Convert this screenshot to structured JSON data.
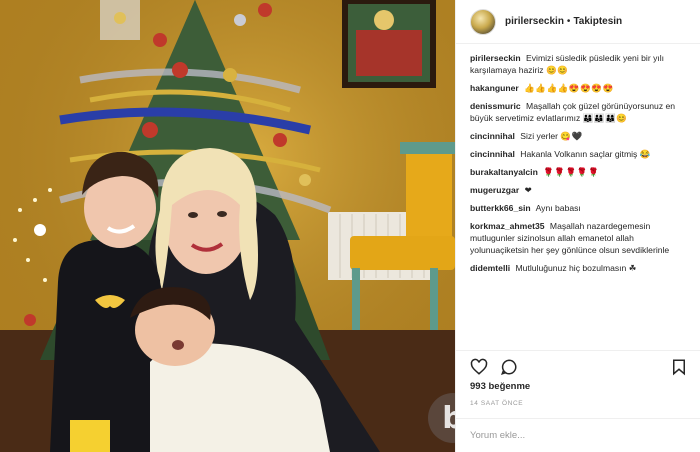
{
  "post": {
    "username": "pirilerseckin",
    "separator": "•",
    "follow_status": "Takiptesin"
  },
  "comments": [
    {
      "user": "pirilerseckin",
      "text": "Evimizi süsledik püsledik yeni bir yılı karşılamaya haziriz",
      "emoji": "😊😊"
    },
    {
      "user": "hakanguner",
      "text": "",
      "emoji": "👍👍👍👍😍😍😍😍"
    },
    {
      "user": "denissmuric",
      "text": "Maşallah çok güzel görünüyorsunuz en büyük servetimiz evlatlarımız",
      "emoji": "👨‍👩‍👦👨‍👩‍👦👨‍👩‍👦😊"
    },
    {
      "user": "cincinnihal",
      "text": "Sizi yerler",
      "emoji": "😋🖤"
    },
    {
      "user": "cincinnihal",
      "text": "Hakanla Volkanın saçlar gitmiş",
      "emoji": "😂"
    },
    {
      "user": "burakaltanyalcin",
      "text": "",
      "emoji": "🌹🌹🌹🌹🌹"
    },
    {
      "user": "mugeruzgar",
      "text": "",
      "emoji": "❤"
    },
    {
      "user": "butterkk66_sin",
      "text": "Aynı babası",
      "emoji": ""
    },
    {
      "user": "korkmaz_ahmet35",
      "text": "Maşallah nazardegemesin mutlugunler sizinolsun allah emanetol allah yolunuaçiketsin her şey gönlünce olsun sevdiklerinle",
      "emoji": ""
    },
    {
      "user": "didemtelli",
      "text": "Mutluluğunuz hiç bozulmasın",
      "emoji": "☘"
    }
  ],
  "stats": {
    "likes": "993 beğenme",
    "time": "14 SAAT ÖNCE"
  },
  "comment_box": {
    "placeholder": "Yorum ekle..."
  },
  "icons": {
    "like": "heart-icon",
    "comment": "comment-bubble-icon",
    "save": "bookmark-icon",
    "watermark": "b"
  }
}
